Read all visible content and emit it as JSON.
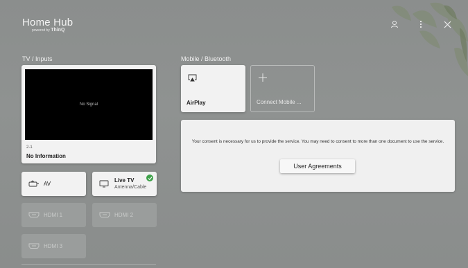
{
  "app": {
    "title": "Home Hub",
    "subtitle_prefix": "powered by",
    "subtitle_brand": "ThinQ"
  },
  "top_icons": [
    "account-icon",
    "more-options-icon",
    "close-icon"
  ],
  "tv_inputs": {
    "section_label": "TV / Inputs",
    "preview": {
      "signal_text": "No Signal",
      "channel": "2-1",
      "info": "No Information"
    },
    "inputs": [
      {
        "label": "AV",
        "icon": "av-input-icon",
        "active": true
      },
      {
        "label": "Live TV",
        "sublabel": "Antenna/Cable",
        "icon": "tv-icon",
        "active": true,
        "connected": true
      },
      {
        "label": "HDMI 1",
        "icon": "hdmi-icon",
        "active": false
      },
      {
        "label": "HDMI 2",
        "icon": "hdmi-icon",
        "active": false
      },
      {
        "label": "HDMI 3",
        "icon": "hdmi-icon",
        "active": false
      }
    ]
  },
  "mobile": {
    "section_label": "Mobile / Bluetooth",
    "cards": [
      {
        "label": "AirPlay",
        "icon": "airplay-icon"
      },
      {
        "label": "Connect Mobile ...",
        "icon": "plus-icon"
      }
    ]
  },
  "consent": {
    "text": "Your consent is necessary for us to provide the service. You may need to consent to more than one document to use the service.",
    "button_label": "User Agreements"
  },
  "colors": {
    "card_bg": "#f2f2f2",
    "check_green": "#3fa24a",
    "background": "#8d908f"
  }
}
